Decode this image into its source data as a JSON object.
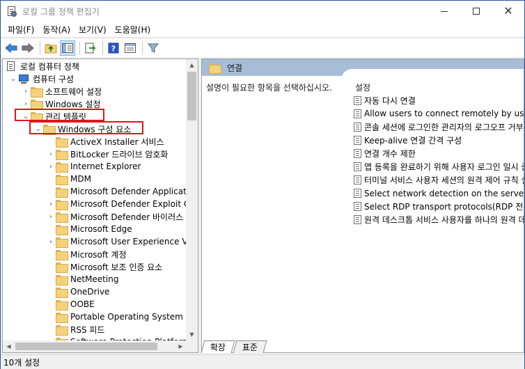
{
  "window": {
    "title": "로컬 그룹 정책 편집기",
    "minimize": "minimize",
    "maximize": "maximize",
    "close": "✕"
  },
  "menu": [
    "파일(F)",
    "동작(A)",
    "보기(V)",
    "도움말(H)"
  ],
  "toolbar": {
    "icons": [
      "back-arrow-icon",
      "forward-arrow-icon",
      "up-folder-icon",
      "show-hide-tree-icon",
      "export-list-icon",
      "help-icon",
      "properties-icon",
      "filter-icon"
    ]
  },
  "tree": {
    "root": "로컬 컴퓨터 정책",
    "computer": "컴퓨터 구성",
    "software_settings": "소프트웨어 설정",
    "windows_settings": "Windows 설정",
    "admin_templates": "관리 템플릿",
    "windows_components": "Windows 구성 요소",
    "children": [
      {
        "label": "ActiveX Installer 서비스",
        "expandable": false
      },
      {
        "label": "BitLocker 드라이브 암호화",
        "expandable": true
      },
      {
        "label": "Internet Explorer",
        "expandable": true
      },
      {
        "label": "MDM",
        "expandable": false
      },
      {
        "label": "Microsoft Defender Application Guard",
        "expandable": false
      },
      {
        "label": "Microsoft Defender Exploit Guard",
        "expandable": true
      },
      {
        "label": "Microsoft Defender 바이러스 백신",
        "expandable": true
      },
      {
        "label": "Microsoft Edge",
        "expandable": false
      },
      {
        "label": "Microsoft User Experience Virtualization",
        "expandable": true
      },
      {
        "label": "Microsoft 계정",
        "expandable": false
      },
      {
        "label": "Microsoft 보조 인증 요소",
        "expandable": false
      },
      {
        "label": "NetMeeting",
        "expandable": false
      },
      {
        "label": "OneDrive",
        "expandable": false
      },
      {
        "label": "OOBE",
        "expandable": false
      },
      {
        "label": "Portable Operating System",
        "expandable": false
      },
      {
        "label": "RSS 피드",
        "expandable": false
      },
      {
        "label": "Software Protection Platform",
        "expandable": false
      }
    ]
  },
  "right": {
    "header": "연결",
    "description": "설명이 필요한 항목을 선택하십시오.",
    "settings_header": "설정",
    "settings": [
      "자동 다시 연결",
      "Allow users to connect remotely by using Remote Desktop Services",
      "콘솔 세션에 로그인한 관리자의 로그오프 거부",
      "Keep-alive 연결 간격 구성",
      "연결 개수 제한",
      "앱 등록을 완료하기 위해 사용자 로그인 일시 중단",
      "터미널 서비스 사용자 세션의 원격 제어 규칙 설정",
      "Select network detection on the server(서버에서 네트워크 검색 선택)",
      "Select RDP transport protocols(RDP 전송 프로토콜 선택)",
      "원격 데스크톱 서비스 사용자를 하나의 원격 데스크톱 서비스 세션으로 제한"
    ]
  },
  "tabs": [
    "확장",
    "표준"
  ],
  "status": "10개 설정",
  "colors": {
    "accent_header": "#a6bdd7",
    "highlight_box": "#e0141e",
    "folder": "#f4d27a"
  }
}
